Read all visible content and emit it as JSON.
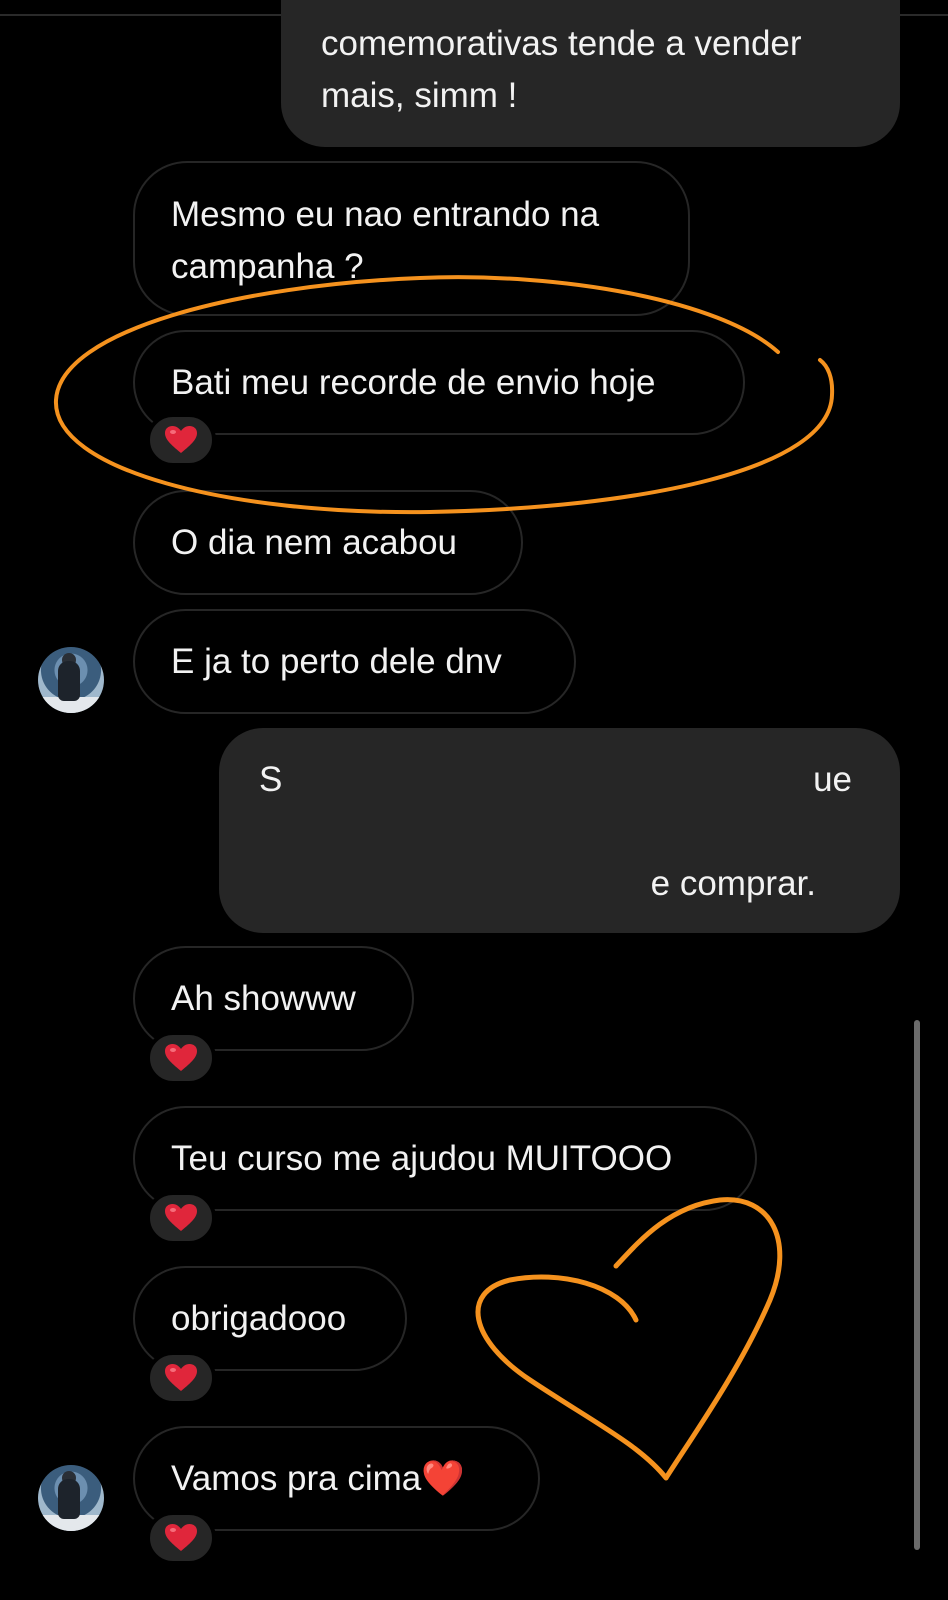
{
  "messages": {
    "m1": {
      "text": "comemorativas tende a vender mais, simm !"
    },
    "m2": {
      "text": "Mesmo eu nao entrando na campanha ?"
    },
    "m3": {
      "text": "Bati meu recorde de envio hoje",
      "reaction": "❤️"
    },
    "m4": {
      "text": "O dia nem acabou"
    },
    "m5": {
      "text": "E ja to perto dele dnv"
    },
    "m6": {
      "fragment_start": "S",
      "fragment_end": "ue",
      "fragment_line2": "e comprar."
    },
    "m7": {
      "text": "Ah showww",
      "reaction": "❤️"
    },
    "m8": {
      "text": "Teu curso me ajudou MUITOOO",
      "reaction": "❤️"
    },
    "m9": {
      "text": "obrigadooo",
      "reaction": "❤️"
    },
    "m10": {
      "text": "Vamos pra cima❤️",
      "reaction": "❤️"
    }
  },
  "colors": {
    "background": "#000000",
    "outgoing_bubble": "#262626",
    "incoming_border": "#262626",
    "annotation": "#f5921e",
    "reaction_heart": "#e0263b"
  },
  "annotations": [
    "orange-ellipse-around-record-message",
    "orange-hand-drawn-heart"
  ]
}
